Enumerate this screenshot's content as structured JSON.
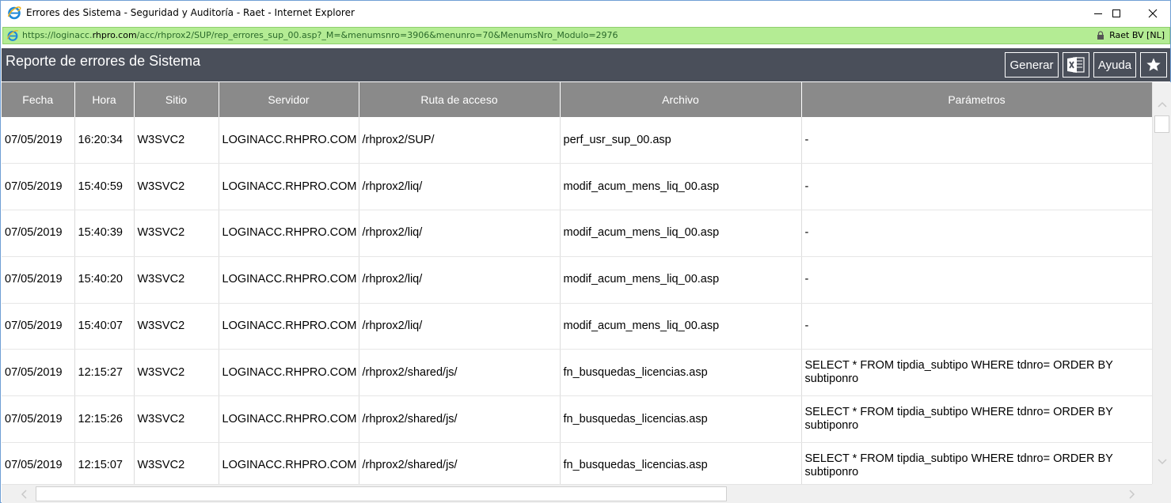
{
  "window": {
    "title": "Errores des Sistema - Seguridad y Auditoría - Raet - Internet Explorer",
    "minimize_icon": "minimize-icon",
    "maximize_icon": "maximize-icon",
    "close_icon": "close-icon"
  },
  "address": {
    "url_prefix": "https://loginacc.",
    "url_domain": "rhpro.com",
    "url_rest": "/acc/rhprox2/SUP/rep_errores_sup_00.asp?_M=&menumsnro=3906&menunro=70&MenumsNro_Modulo=2976",
    "site_identity": "Raet BV [NL]",
    "lock_icon": "lock-icon"
  },
  "header": {
    "title": "Reporte de errores de Sistema",
    "generar_label": "Generar",
    "excel_icon": "excel-icon",
    "ayuda_label": "Ayuda",
    "star_icon": "star-icon"
  },
  "table": {
    "columns": [
      "Fecha",
      "Hora",
      "Sitio",
      "Servidor",
      "Ruta de acceso",
      "Archivo",
      "Parámetros"
    ],
    "rows": [
      [
        "07/05/2019",
        "16:20:34",
        "W3SVC2",
        "LOGINACC.RHPRO.COM",
        "/rhprox2/SUP/",
        "perf_usr_sup_00.asp",
        "-"
      ],
      [
        "07/05/2019",
        "15:40:59",
        "W3SVC2",
        "LOGINACC.RHPRO.COM",
        "/rhprox2/liq/",
        "modif_acum_mens_liq_00.asp",
        "-"
      ],
      [
        "07/05/2019",
        "15:40:39",
        "W3SVC2",
        "LOGINACC.RHPRO.COM",
        "/rhprox2/liq/",
        "modif_acum_mens_liq_00.asp",
        "-"
      ],
      [
        "07/05/2019",
        "15:40:20",
        "W3SVC2",
        "LOGINACC.RHPRO.COM",
        "/rhprox2/liq/",
        "modif_acum_mens_liq_00.asp",
        "-"
      ],
      [
        "07/05/2019",
        "15:40:07",
        "W3SVC2",
        "LOGINACC.RHPRO.COM",
        "/rhprox2/liq/",
        "modif_acum_mens_liq_00.asp",
        "-"
      ],
      [
        "07/05/2019",
        "12:15:27",
        "W3SVC2",
        "LOGINACC.RHPRO.COM",
        "/rhprox2/shared/js/",
        "fn_busquedas_licencias.asp",
        "SELECT * FROM tipdia_subtipo WHERE tdnro= ORDER BY subtiponro"
      ],
      [
        "07/05/2019",
        "12:15:26",
        "W3SVC2",
        "LOGINACC.RHPRO.COM",
        "/rhprox2/shared/js/",
        "fn_busquedas_licencias.asp",
        "SELECT * FROM tipdia_subtipo WHERE tdnro= ORDER BY subtiponro"
      ],
      [
        "07/05/2019",
        "12:15:07",
        "W3SVC2",
        "LOGINACC.RHPRO.COM",
        "/rhprox2/shared/js/",
        "fn_busquedas_licencias.asp",
        "SELECT * FROM tipdia_subtipo WHERE tdnro= ORDER BY subtiponro"
      ]
    ]
  },
  "colors": {
    "header_bg": "#4a4f5a",
    "table_head_bg": "#8a8a8a",
    "address_bg": "#b4ec94"
  }
}
